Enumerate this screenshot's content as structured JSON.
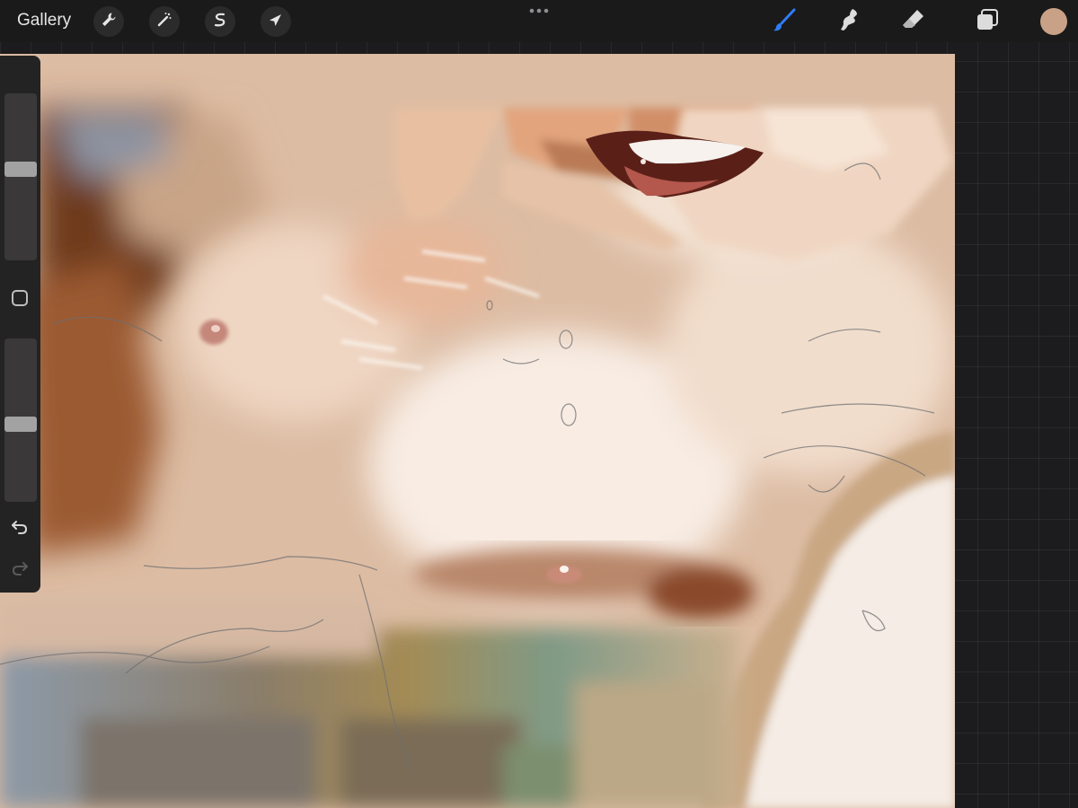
{
  "toolbar": {
    "gallery_label": "Gallery",
    "left_tools": [
      {
        "name": "actions",
        "icon": "wrench-icon"
      },
      {
        "name": "adjustments",
        "icon": "magic-wand-icon"
      },
      {
        "name": "selection",
        "icon": "selection-s-icon"
      },
      {
        "name": "transform",
        "icon": "arrow-cursor-icon"
      }
    ],
    "more_icon": "more-dots-icon",
    "right_tools": [
      {
        "name": "brush",
        "icon": "brush-icon",
        "active": true
      },
      {
        "name": "smudge",
        "icon": "smudge-icon",
        "active": false
      },
      {
        "name": "eraser",
        "icon": "eraser-icon",
        "active": false
      },
      {
        "name": "layers",
        "icon": "layers-icon",
        "active": false
      }
    ],
    "current_color": "#c9a186"
  },
  "sidebar": {
    "brush_size_slider": {
      "level": 0.55
    },
    "opacity_slider": {
      "level": 0.47
    },
    "modify_icon": "square-icon",
    "undo_icon": "undo-icon",
    "redo_icon": "redo-icon"
  },
  "colors": {
    "accent_active_tool": "#2f7cf6",
    "toolbar_bg": "#1a1a1a",
    "workspace_bg": "#1c1c1e"
  }
}
